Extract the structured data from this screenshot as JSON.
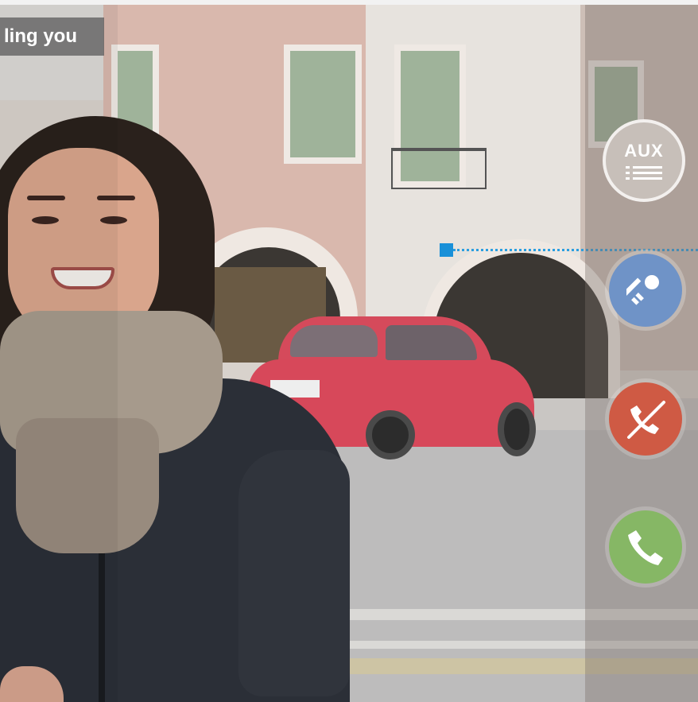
{
  "call": {
    "status_label": "ling you"
  },
  "controls": {
    "aux_label": "AUX",
    "key_icon": "key-icon",
    "hangup_icon": "hang-up-icon",
    "answer_icon": "phone-answer-icon"
  },
  "colors": {
    "aux_button": "#c7bfb9",
    "key_button": "#6f93c7",
    "hangup_button": "#cf5a44",
    "answer_button": "#86b765",
    "hotspot": "#1990d8"
  }
}
